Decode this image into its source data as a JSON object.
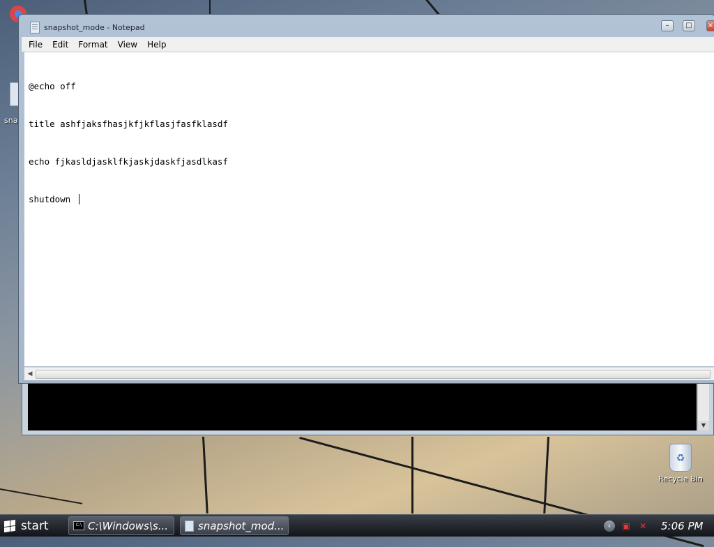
{
  "notepad": {
    "title": "snapshot_mode - Notepad",
    "menu": [
      "File",
      "Edit",
      "Format",
      "View",
      "Help"
    ],
    "lines": [
      "@echo off",
      "title ashfjaksfhasjkfjkflasjfasfklasdf",
      "echo fjkasldjasklfkjaskjdaskfjasdlkasf",
      "shutdown "
    ]
  },
  "desktop": {
    "partial_icon_label": "snap",
    "recycle_bin_label": "Recycle Bin"
  },
  "taskbar": {
    "start_label": "start",
    "tasks": [
      {
        "label": "C:\\Windows\\s...",
        "icon": "console-icon"
      },
      {
        "label": "snapshot_mod...",
        "icon": "notepad-icon"
      }
    ],
    "time": "5:06 PM"
  },
  "icons": {
    "window_minimize": "minimize-icon",
    "window_maximize": "maximize-icon",
    "window_close": "close-icon",
    "tray_expand": "chevron-left-icon",
    "tray_network": "network-icon",
    "tray_volume": "volume-muted-icon"
  }
}
